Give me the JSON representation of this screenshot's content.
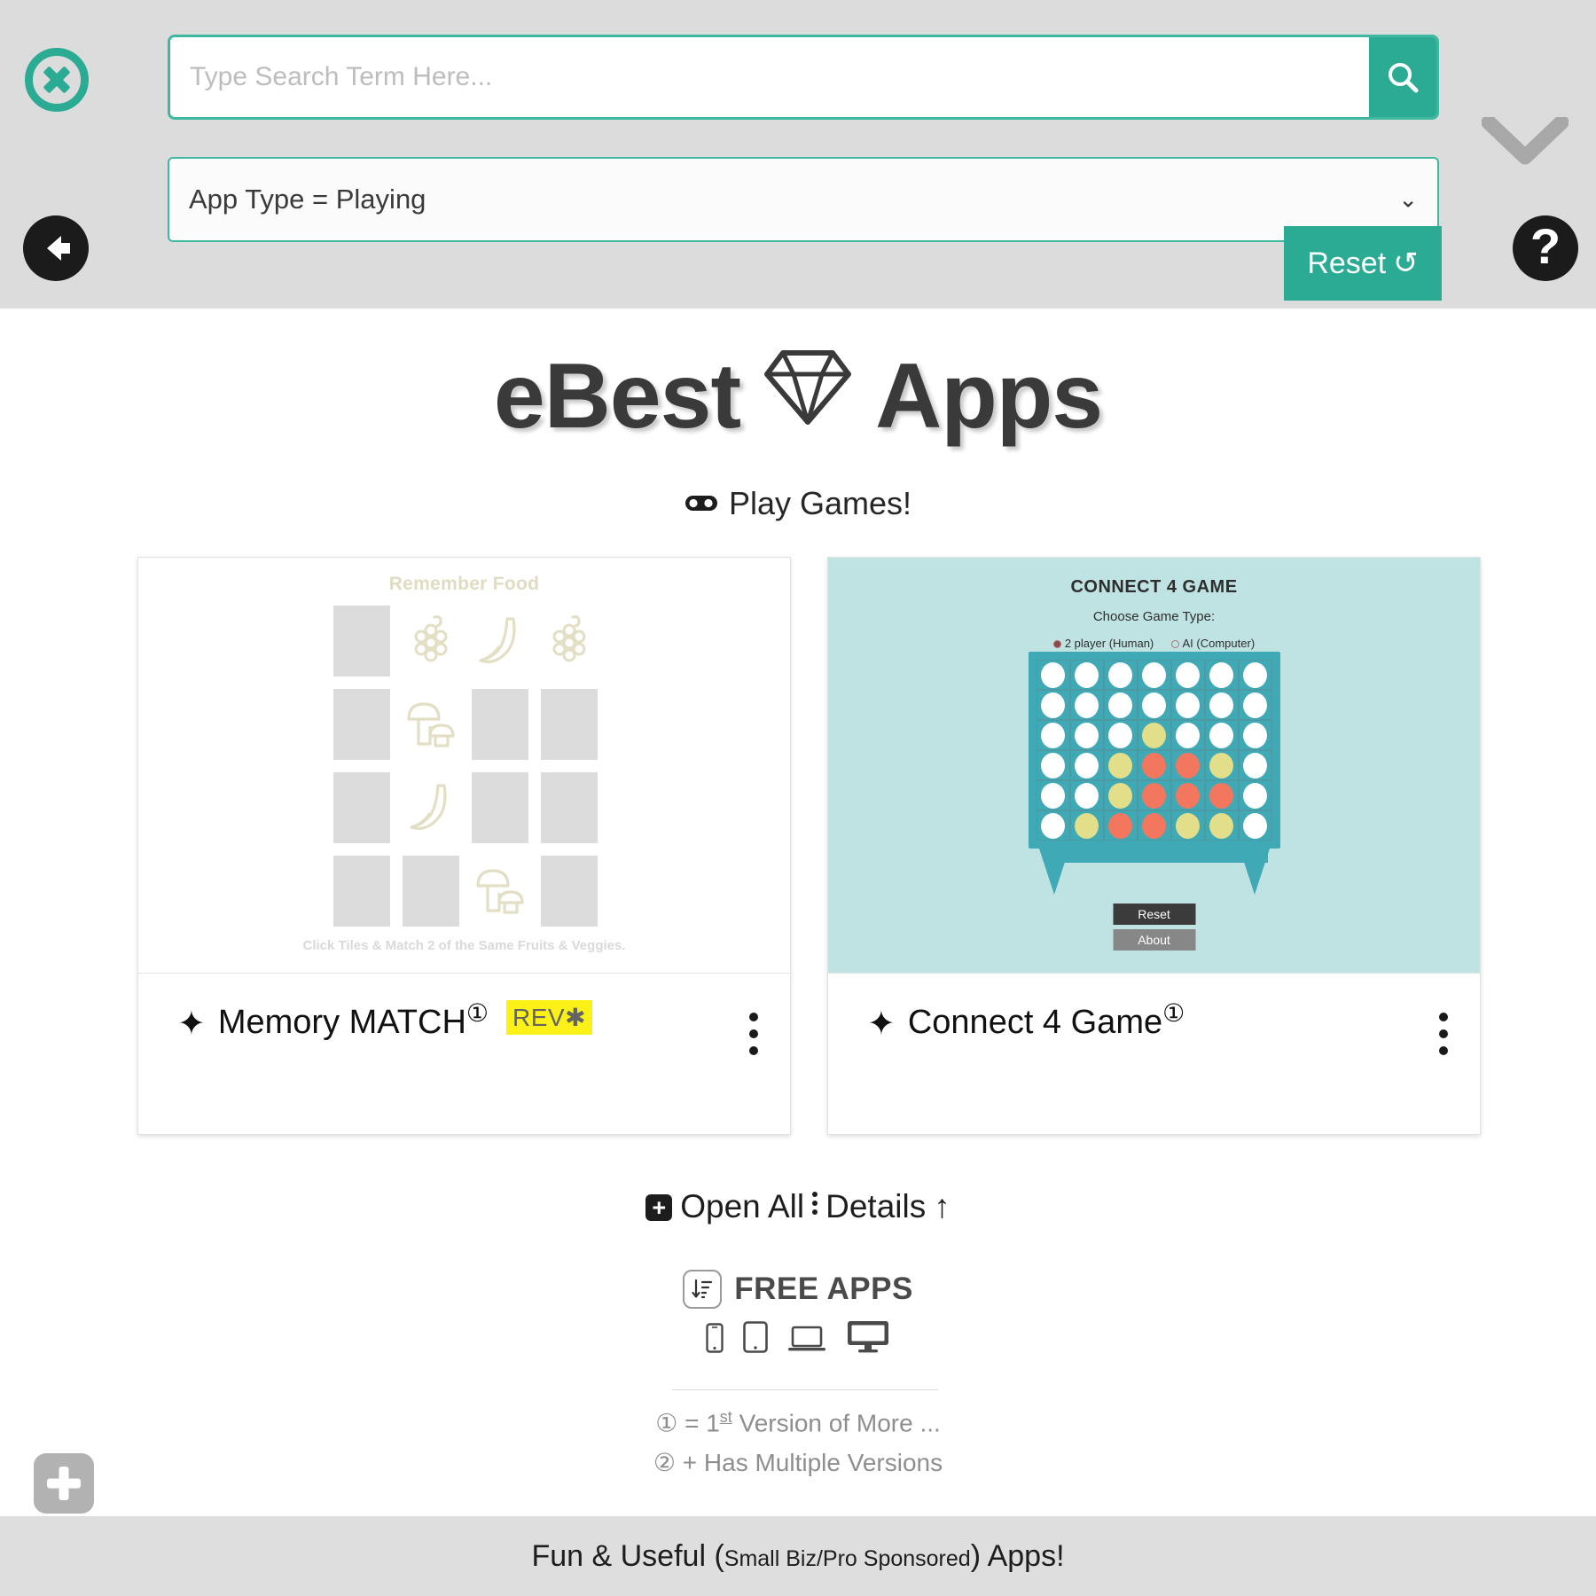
{
  "topbar": {
    "close_icon": "close-x-circle-icon",
    "back_icon": "back-arrow-icon",
    "chevron_icon": "chevron-down-icon",
    "help_icon": "help-question-icon",
    "help_glyph": "?",
    "search": {
      "placeholder": "Type Search Term Here...",
      "value": "",
      "button_icon": "search-icon"
    },
    "filter": {
      "value": "App Type = Playing",
      "caret": "⌄"
    },
    "reset": {
      "label": "Reset",
      "icon": "↺"
    },
    "accent_color": "#2bab94",
    "bar_color": "#dcdcdc"
  },
  "brand": {
    "text_before": "eBest",
    "icon": "diamond-icon",
    "text_after": "Apps"
  },
  "subtitle": {
    "icon": "gamepad-icon",
    "label": "Play Games!"
  },
  "cards": [
    {
      "name": "Memory MATCH",
      "title": "Memory MATCH",
      "star": "✦",
      "version_mark": "①",
      "badge": "REV",
      "badge_star": "✱",
      "badge_color": "#fbf117",
      "menu_icon": "kebab-menu-icon",
      "preview": {
        "kind": "memory-match",
        "title": "Remember Food",
        "hint": "Click Tiles & Match 2 of the Same Fruits & Veggies.",
        "tiles": [
          "hidden",
          "grapes",
          "banana",
          "grapes",
          "hidden",
          "mushroom",
          "hidden",
          "hidden",
          "hidden",
          "banana",
          "hidden",
          "hidden",
          "hidden",
          "hidden",
          "mushroom",
          "hidden"
        ],
        "tile_color": "#dcdcdc",
        "fruit_color": "#e3dfc4"
      }
    },
    {
      "name": "Connect 4 Game",
      "title": "Connect 4 Game",
      "star": "✦",
      "version_mark": "①",
      "badge": "",
      "badge_star": "",
      "menu_icon": "kebab-menu-icon",
      "preview": {
        "kind": "connect-4",
        "title": "CONNECT 4 GAME",
        "subtitle": "Choose Game Type:",
        "option_1": "2 player (Human)",
        "option_2": "AI (Computer)",
        "selected_option": "2 player (Human)",
        "reset_label": "Reset",
        "about_label": "About",
        "background": "#bfe3e3",
        "board_color": "#3fa9b5",
        "disc_colors": {
          "empty": "#ffffff",
          "yellow": "#e2de8a",
          "red": "#f3775f"
        },
        "board": [
          [
            "empty",
            "empty",
            "empty",
            "empty",
            "empty",
            "empty",
            "empty"
          ],
          [
            "empty",
            "empty",
            "empty",
            "empty",
            "empty",
            "empty",
            "empty"
          ],
          [
            "empty",
            "empty",
            "empty",
            "yellow",
            "empty",
            "empty",
            "empty"
          ],
          [
            "empty",
            "empty",
            "yellow",
            "red",
            "red",
            "yellow",
            "empty"
          ],
          [
            "empty",
            "empty",
            "yellow",
            "red",
            "red",
            "red",
            "empty"
          ],
          [
            "empty",
            "yellow",
            "red",
            "red",
            "yellow",
            "yellow",
            "empty"
          ]
        ]
      }
    }
  ],
  "open_all": {
    "plus_icon": "square-plus-icon",
    "label": "Open All",
    "separator_icon": "vertical-dots-icon",
    "details_label": "Details",
    "up_arrow": "↑"
  },
  "free_apps": {
    "sort_icon": "sort-descending-icon",
    "title": "FREE APPS",
    "devices": [
      "mobile-icon",
      "tablet-icon",
      "laptop-icon",
      "desktop-icon"
    ]
  },
  "legend": [
    {
      "mark": "①",
      "text": "= 1",
      "sup": "st",
      "rest": " Version of More ..."
    },
    {
      "mark": "②",
      "text": "+ Has Multiple Versions",
      "sup": "",
      "rest": ""
    }
  ],
  "add_button": {
    "icon": "plus-square-icon"
  },
  "footer": {
    "text_1": "Fun & Useful (",
    "text_small": "Small Biz/Pro Sponsored",
    "text_2": ") Apps!"
  }
}
